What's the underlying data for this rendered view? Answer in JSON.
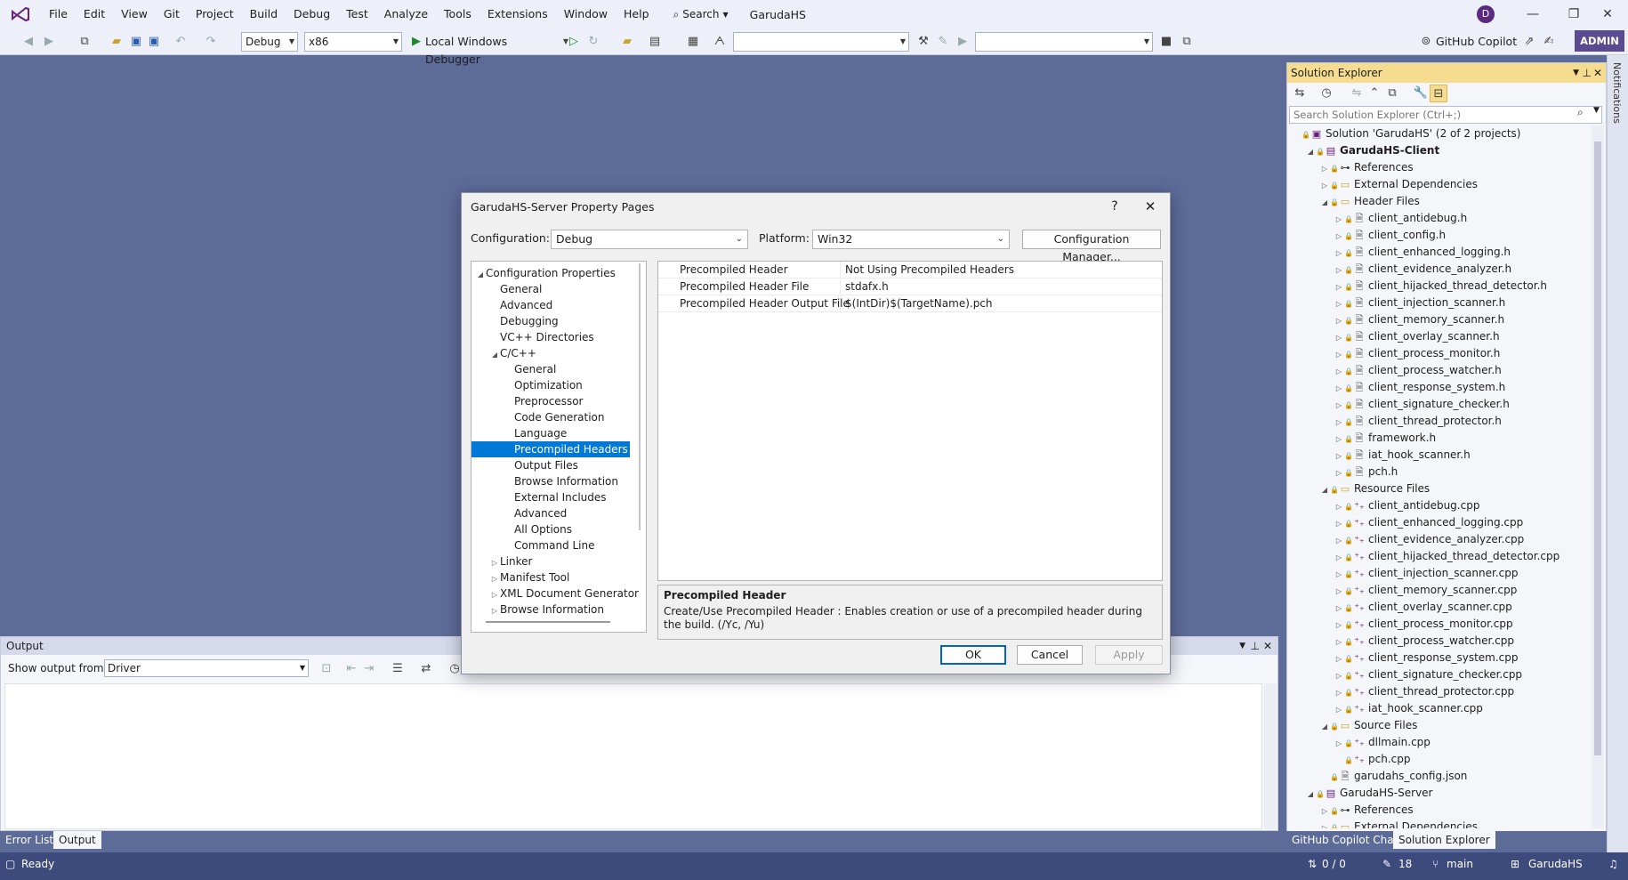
{
  "app": {
    "menu": [
      "File",
      "Edit",
      "View",
      "Git",
      "Project",
      "Build",
      "Debug",
      "Test",
      "Analyze",
      "Tools",
      "Extensions",
      "Window",
      "Help"
    ],
    "search_label": "Search",
    "solution_name": "GarudaHS",
    "avatar_initial": "D",
    "accent": "#5d6b99"
  },
  "toolbar": {
    "config": "Debug",
    "platform": "x86",
    "debugger_label": "Local Windows Debugger",
    "copilot_label": "GitHub Copilot",
    "admin_badge": "ADMIN"
  },
  "notifications_label": "Notifications",
  "solution_explorer": {
    "title": "Solution Explorer",
    "search_placeholder": "Search Solution Explorer (Ctrl+;)",
    "items": [
      {
        "label": "Solution 'GarudaHS' (2 of 2 projects)",
        "level": 0,
        "arrow": "",
        "icon": "solution-icon",
        "glyph": "▣",
        "bold": false
      },
      {
        "label": "GarudaHS-Client",
        "level": 1,
        "arrow": "◢",
        "icon": "project-icon",
        "glyph": "▤",
        "bold": true
      },
      {
        "label": "References",
        "level": 2,
        "arrow": "▷",
        "icon": "references-icon",
        "glyph": "⊶",
        "bold": false
      },
      {
        "label": "External Dependencies",
        "level": 2,
        "arrow": "▷",
        "icon": "folder-icon",
        "glyph": "▭",
        "bold": false
      },
      {
        "label": "Header Files",
        "level": 2,
        "arrow": "◢",
        "icon": "folder-icon",
        "glyph": "▭",
        "bold": false
      },
      {
        "label": "client_antidebug.h",
        "level": 3,
        "arrow": "▷",
        "icon": "header-file-icon",
        "glyph": "🗎",
        "bold": false
      },
      {
        "label": "client_config.h",
        "level": 3,
        "arrow": "▷",
        "icon": "header-file-icon",
        "glyph": "🗎",
        "bold": false
      },
      {
        "label": "client_enhanced_logging.h",
        "level": 3,
        "arrow": "▷",
        "icon": "header-file-icon",
        "glyph": "🗎",
        "bold": false
      },
      {
        "label": "client_evidence_analyzer.h",
        "level": 3,
        "arrow": "▷",
        "icon": "header-file-icon",
        "glyph": "🗎",
        "bold": false
      },
      {
        "label": "client_hijacked_thread_detector.h",
        "level": 3,
        "arrow": "▷",
        "icon": "header-file-icon",
        "glyph": "🗎",
        "bold": false
      },
      {
        "label": "client_injection_scanner.h",
        "level": 3,
        "arrow": "▷",
        "icon": "header-file-icon",
        "glyph": "🗎",
        "bold": false
      },
      {
        "label": "client_memory_scanner.h",
        "level": 3,
        "arrow": "▷",
        "icon": "header-file-icon",
        "glyph": "🗎",
        "bold": false
      },
      {
        "label": "client_overlay_scanner.h",
        "level": 3,
        "arrow": "▷",
        "icon": "header-file-icon",
        "glyph": "🗎",
        "bold": false
      },
      {
        "label": "client_process_monitor.h",
        "level": 3,
        "arrow": "▷",
        "icon": "header-file-icon",
        "glyph": "🗎",
        "bold": false
      },
      {
        "label": "client_process_watcher.h",
        "level": 3,
        "arrow": "▷",
        "icon": "header-file-icon",
        "glyph": "🗎",
        "bold": false
      },
      {
        "label": "client_response_system.h",
        "level": 3,
        "arrow": "▷",
        "icon": "header-file-icon",
        "glyph": "🗎",
        "bold": false
      },
      {
        "label": "client_signature_checker.h",
        "level": 3,
        "arrow": "▷",
        "icon": "header-file-icon",
        "glyph": "🗎",
        "bold": false
      },
      {
        "label": "client_thread_protector.h",
        "level": 3,
        "arrow": "▷",
        "icon": "header-file-icon",
        "glyph": "🗎",
        "bold": false
      },
      {
        "label": "framework.h",
        "level": 3,
        "arrow": "▷",
        "icon": "header-file-icon",
        "glyph": "🗎",
        "bold": false
      },
      {
        "label": "iat_hook_scanner.h",
        "level": 3,
        "arrow": "▷",
        "icon": "header-file-icon",
        "glyph": "🗎",
        "bold": false
      },
      {
        "label": "pch.h",
        "level": 3,
        "arrow": "▷",
        "icon": "header-file-icon",
        "glyph": "🗎",
        "bold": false
      },
      {
        "label": "Resource Files",
        "level": 2,
        "arrow": "◢",
        "icon": "folder-icon",
        "glyph": "▭",
        "bold": false
      },
      {
        "label": "client_antidebug.cpp",
        "level": 3,
        "arrow": "▷",
        "icon": "cpp-file-icon",
        "glyph": "⁺₊",
        "bold": false
      },
      {
        "label": "client_enhanced_logging.cpp",
        "level": 3,
        "arrow": "▷",
        "icon": "cpp-file-icon",
        "glyph": "⁺₊",
        "bold": false
      },
      {
        "label": "client_evidence_analyzer.cpp",
        "level": 3,
        "arrow": "▷",
        "icon": "cpp-file-icon",
        "glyph": "⁺₊",
        "bold": false
      },
      {
        "label": "client_hijacked_thread_detector.cpp",
        "level": 3,
        "arrow": "▷",
        "icon": "cpp-file-icon",
        "glyph": "⁺₊",
        "bold": false
      },
      {
        "label": "client_injection_scanner.cpp",
        "level": 3,
        "arrow": "▷",
        "icon": "cpp-file-icon",
        "glyph": "⁺₊",
        "bold": false
      },
      {
        "label": "client_memory_scanner.cpp",
        "level": 3,
        "arrow": "▷",
        "icon": "cpp-file-icon",
        "glyph": "⁺₊",
        "bold": false
      },
      {
        "label": "client_overlay_scanner.cpp",
        "level": 3,
        "arrow": "▷",
        "icon": "cpp-file-icon",
        "glyph": "⁺₊",
        "bold": false
      },
      {
        "label": "client_process_monitor.cpp",
        "level": 3,
        "arrow": "▷",
        "icon": "cpp-file-icon",
        "glyph": "⁺₊",
        "bold": false
      },
      {
        "label": "client_process_watcher.cpp",
        "level": 3,
        "arrow": "▷",
        "icon": "cpp-file-icon",
        "glyph": "⁺₊",
        "bold": false
      },
      {
        "label": "client_response_system.cpp",
        "level": 3,
        "arrow": "▷",
        "icon": "cpp-file-icon",
        "glyph": "⁺₊",
        "bold": false
      },
      {
        "label": "client_signature_checker.cpp",
        "level": 3,
        "arrow": "▷",
        "icon": "cpp-file-icon",
        "glyph": "⁺₊",
        "bold": false
      },
      {
        "label": "client_thread_protector.cpp",
        "level": 3,
        "arrow": "▷",
        "icon": "cpp-file-icon",
        "glyph": "⁺₊",
        "bold": false
      },
      {
        "label": "iat_hook_scanner.cpp",
        "level": 3,
        "arrow": "▷",
        "icon": "cpp-file-icon",
        "glyph": "⁺₊",
        "bold": false
      },
      {
        "label": "Source Files",
        "level": 2,
        "arrow": "◢",
        "icon": "folder-icon",
        "glyph": "▭",
        "bold": false
      },
      {
        "label": "dllmain.cpp",
        "level": 3,
        "arrow": "▷",
        "icon": "cpp-file-icon",
        "glyph": "⁺₊",
        "bold": false
      },
      {
        "label": "pch.cpp",
        "level": 3,
        "arrow": "",
        "icon": "cpp-file-icon",
        "glyph": "⁺₊",
        "bold": false
      },
      {
        "label": "garudahs_config.json",
        "level": 2,
        "arrow": "",
        "icon": "json-file-icon",
        "glyph": "🗎",
        "bold": false
      },
      {
        "label": "GarudaHS-Server",
        "level": 1,
        "arrow": "◢",
        "icon": "project-icon",
        "glyph": "▤",
        "bold": false
      },
      {
        "label": "References",
        "level": 2,
        "arrow": "▷",
        "icon": "references-icon",
        "glyph": "⊶",
        "bold": false
      },
      {
        "label": "External Dependencies",
        "level": 2,
        "arrow": "▷",
        "icon": "folder-icon",
        "glyph": "▭",
        "bold": false
      }
    ],
    "tabs": [
      "GitHub Copilot Chat",
      "Solution Explorer"
    ]
  },
  "output": {
    "title": "Output",
    "show_from_label": "Show output from:",
    "source": "Driver",
    "tabs": [
      "Error List",
      "Output"
    ]
  },
  "status": {
    "ready": "Ready",
    "git_changes": "0 / 0",
    "pending": "18",
    "branch": "main",
    "repo": "GarudaHS"
  },
  "dialog": {
    "title": "GarudaHS-Server Property Pages",
    "configuration_label": "Configuration:",
    "configuration_value": "Debug",
    "platform_label": "Platform:",
    "platform_value": "Win32",
    "config_manager_button": "Configuration Manager...",
    "tree": [
      {
        "label": "Configuration Properties",
        "level": 0,
        "arrow": "◢",
        "selected": false
      },
      {
        "label": "General",
        "level": 1,
        "arrow": "",
        "selected": false
      },
      {
        "label": "Advanced",
        "level": 1,
        "arrow": "",
        "selected": false
      },
      {
        "label": "Debugging",
        "level": 1,
        "arrow": "",
        "selected": false
      },
      {
        "label": "VC++ Directories",
        "level": 1,
        "arrow": "",
        "selected": false
      },
      {
        "label": "C/C++",
        "level": 1,
        "arrow": "◢",
        "selected": false
      },
      {
        "label": "General",
        "level": 2,
        "arrow": "",
        "selected": false
      },
      {
        "label": "Optimization",
        "level": 2,
        "arrow": "",
        "selected": false
      },
      {
        "label": "Preprocessor",
        "level": 2,
        "arrow": "",
        "selected": false
      },
      {
        "label": "Code Generation",
        "level": 2,
        "arrow": "",
        "selected": false
      },
      {
        "label": "Language",
        "level": 2,
        "arrow": "",
        "selected": false
      },
      {
        "label": "Precompiled Headers",
        "level": 2,
        "arrow": "",
        "selected": true
      },
      {
        "label": "Output Files",
        "level": 2,
        "arrow": "",
        "selected": false
      },
      {
        "label": "Browse Information",
        "level": 2,
        "arrow": "",
        "selected": false
      },
      {
        "label": "External Includes",
        "level": 2,
        "arrow": "",
        "selected": false
      },
      {
        "label": "Advanced",
        "level": 2,
        "arrow": "",
        "selected": false
      },
      {
        "label": "All Options",
        "level": 2,
        "arrow": "",
        "selected": false
      },
      {
        "label": "Command Line",
        "level": 2,
        "arrow": "",
        "selected": false
      },
      {
        "label": "Linker",
        "level": 1,
        "arrow": "▷",
        "selected": false
      },
      {
        "label": "Manifest Tool",
        "level": 1,
        "arrow": "▷",
        "selected": false
      },
      {
        "label": "XML Document Generator",
        "level": 1,
        "arrow": "▷",
        "selected": false
      },
      {
        "label": "Browse Information",
        "level": 1,
        "arrow": "▷",
        "selected": false
      }
    ],
    "properties": [
      {
        "name": "Precompiled Header",
        "value": "Not Using Precompiled Headers"
      },
      {
        "name": "Precompiled Header File",
        "value": "stdafx.h"
      },
      {
        "name": "Precompiled Header Output File",
        "value": "$(IntDir)$(TargetName).pch"
      }
    ],
    "description_title": "Precompiled Header",
    "description_text": "Create/Use Precompiled Header : Enables creation or use of a precompiled header during the build. (/Yc, /Yu)",
    "ok_button": "OK",
    "cancel_button": "Cancel",
    "apply_button": "Apply"
  }
}
